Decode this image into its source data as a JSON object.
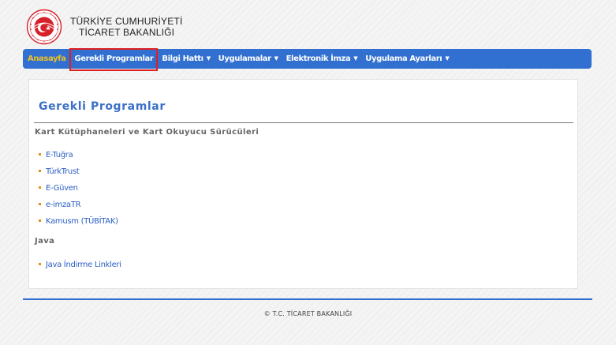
{
  "header": {
    "org_line1": "TÜRKİYE CUMHURİYETİ",
    "org_line2": "TİCARET BAKANLIĞI",
    "logo_icon": "ministry-emblem",
    "logo_color": "#d6202a"
  },
  "nav": {
    "items": [
      {
        "label": "Anasayfa",
        "dropdown": false
      },
      {
        "label": "Gerekli Programlar",
        "dropdown": false,
        "active": true
      },
      {
        "label": "Bilgi Hattı",
        "dropdown": true
      },
      {
        "label": "Uygulamalar",
        "dropdown": true
      },
      {
        "label": "Elektronik İmza",
        "dropdown": true
      },
      {
        "label": "Uygulama Ayarları",
        "dropdown": true
      }
    ],
    "caret": "▼",
    "color": "#3170d0",
    "highlight_color": "#e02020"
  },
  "main": {
    "title": "Gerekli Programlar",
    "sections": [
      {
        "heading": "Kart Kütüphaneleri ve Kart Okuyucu Sürücüleri",
        "links": [
          "E-Tuğra",
          "TürkTrust",
          "E-Güven",
          "e-imzaTR",
          "Kamusm (TÜBİTAK)"
        ]
      },
      {
        "heading": "Java",
        "links": [
          "Java İndirme Linkleri"
        ]
      }
    ]
  },
  "footer": {
    "text": "© T.C. TİCARET BAKANLIĞI"
  }
}
